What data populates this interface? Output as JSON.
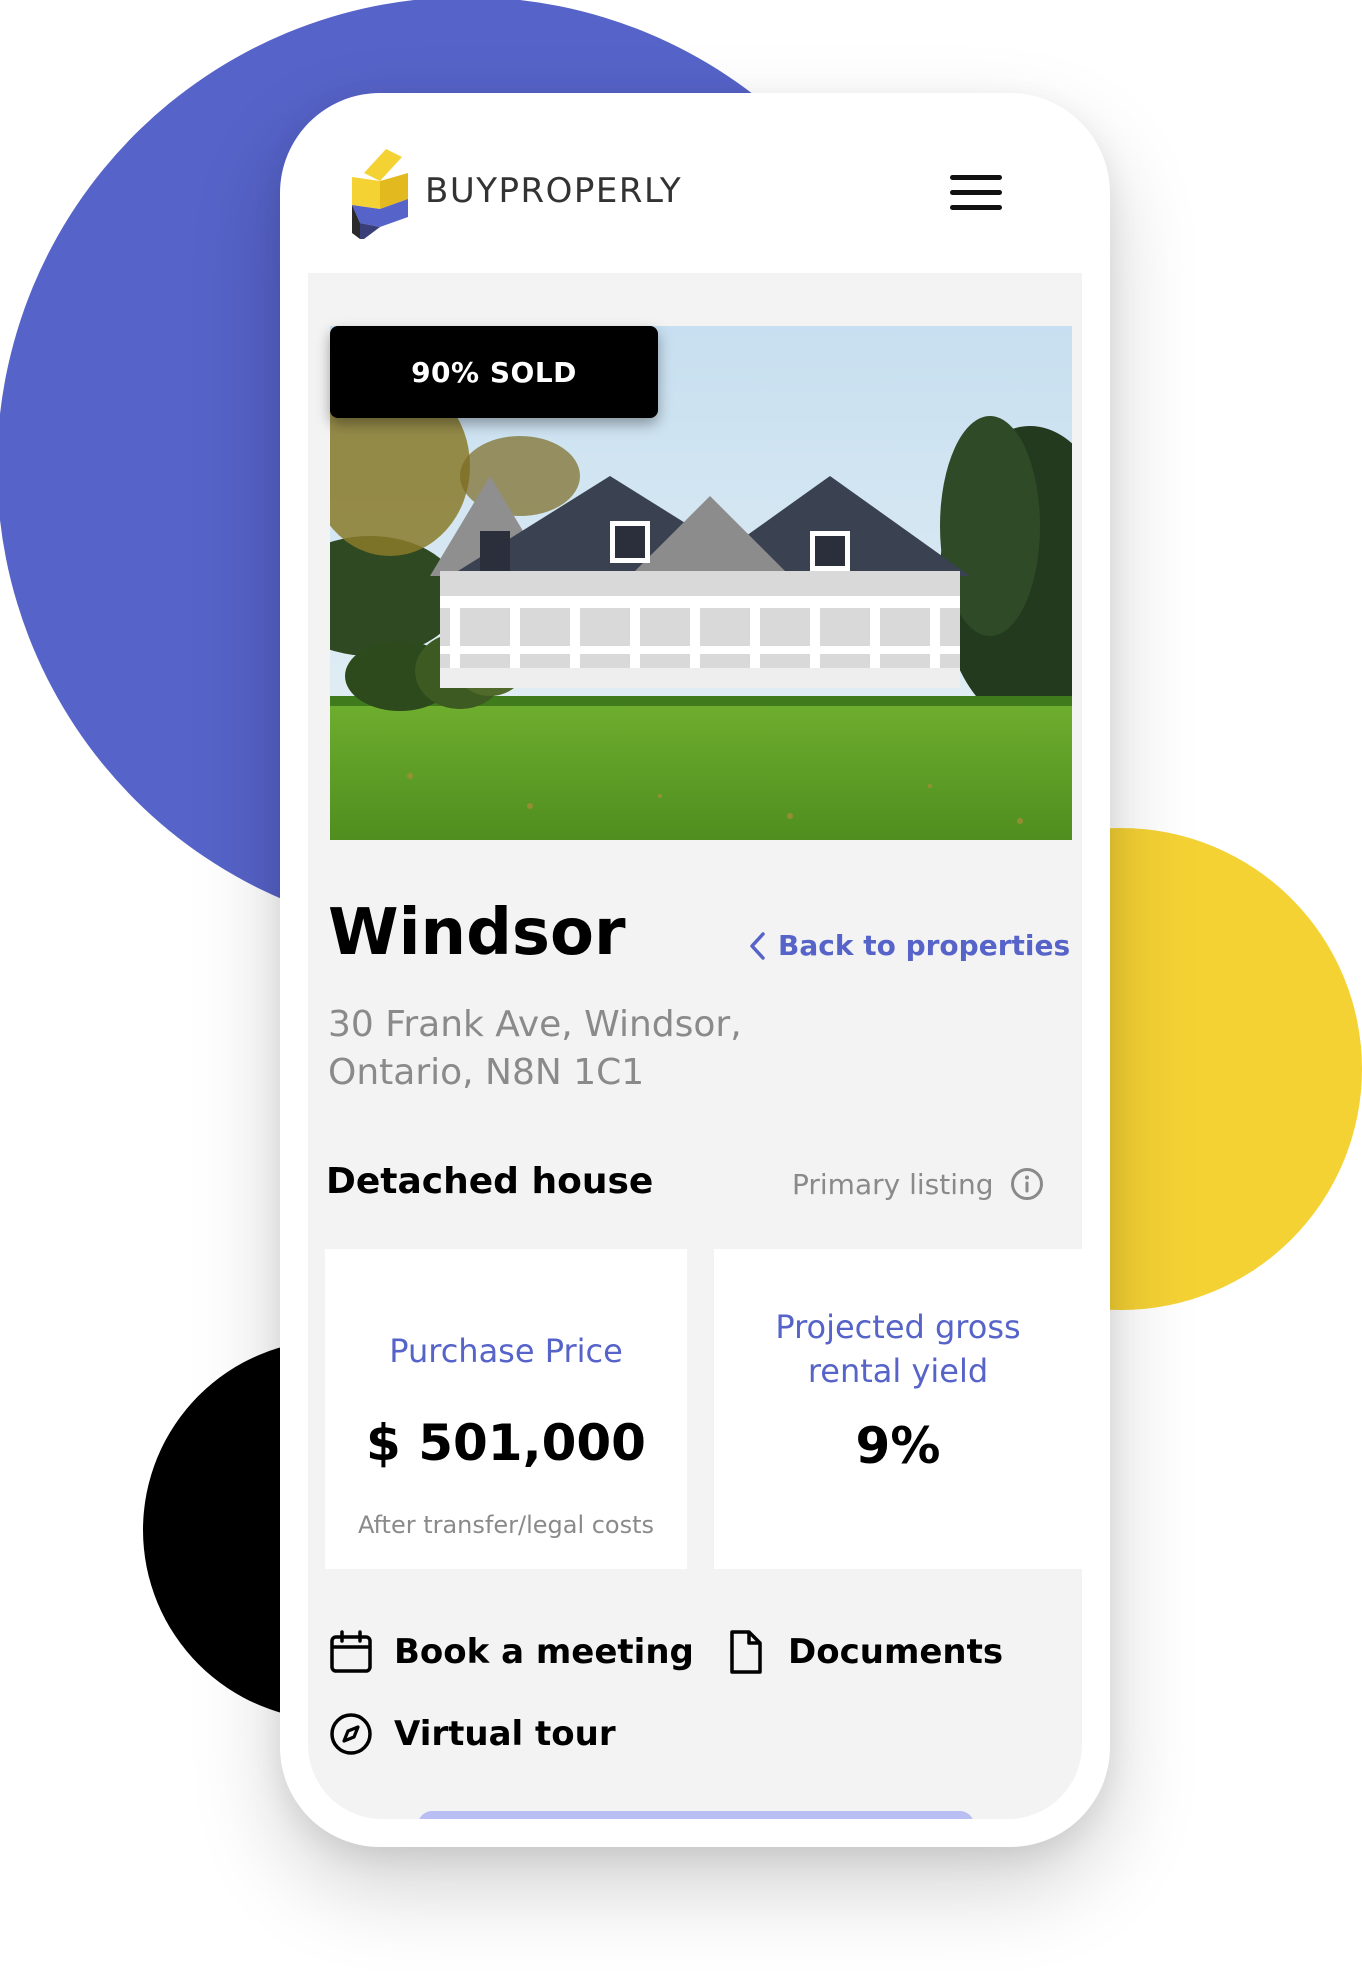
{
  "header": {
    "brand": "BUYPROPERLY",
    "brand_colors": {
      "yellow": "#f5d234",
      "blue": "#5663c8",
      "dark": "#333333"
    }
  },
  "hero": {
    "badge": "90% SOLD"
  },
  "listing": {
    "title": "Windsor",
    "back_link": "Back to properties",
    "address_line1": "30 Frank Ave, Windsor,",
    "address_line2": "Ontario, N8N 1C1",
    "property_type": "Detached house",
    "listing_type": "Primary listing"
  },
  "stats": {
    "price_label": "Purchase Price",
    "price_value": "$ 501,000",
    "price_note": "After transfer/legal costs",
    "yield_label_line1": "Projected gross",
    "yield_label_line2": "rental yield",
    "yield_value": "9%"
  },
  "actions": {
    "meeting": "Book a meeting",
    "documents": "Documents",
    "tour": "Virtual tour"
  },
  "colors": {
    "accent": "#5663c8",
    "yellow": "#f5d234",
    "black": "#000000",
    "screen_bg": "#f3f3f3"
  }
}
